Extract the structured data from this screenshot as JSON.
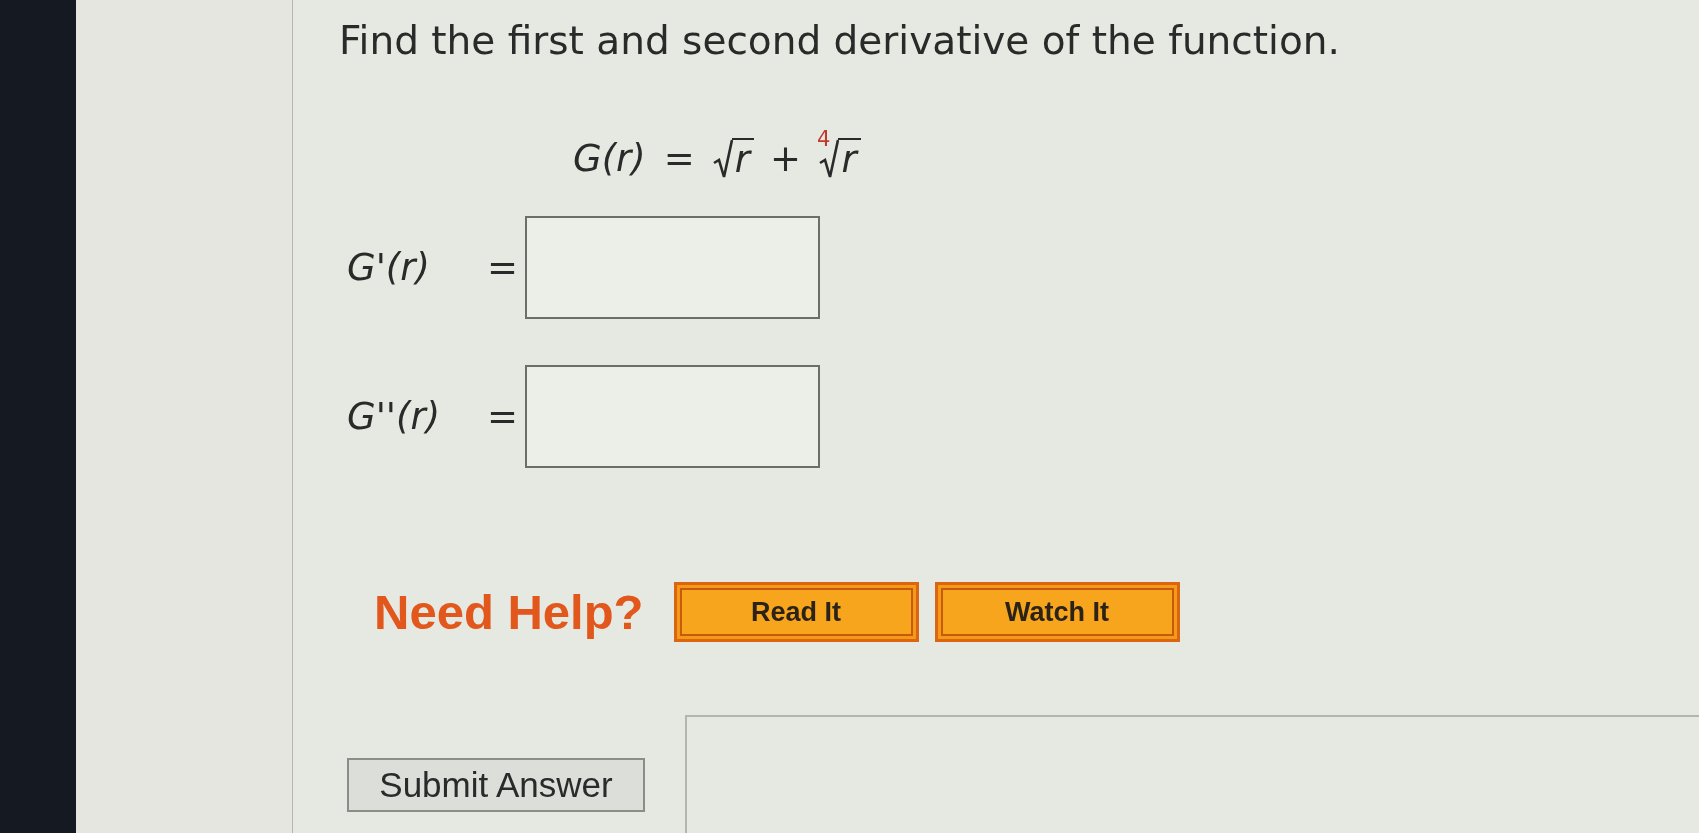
{
  "question": {
    "prompt": "Find the first and second derivative of the function."
  },
  "function": {
    "lhs": "G(r)",
    "equals": "=",
    "terms": [
      {
        "kind": "sqrt",
        "radicand": "r"
      },
      {
        "kind": "operator",
        "symbol": "+"
      },
      {
        "kind": "root",
        "index": "4",
        "radicand": "r"
      }
    ]
  },
  "answers": [
    {
      "label": "G'(r)",
      "equals": "="
    },
    {
      "label": "G''(r)",
      "equals": "="
    }
  ],
  "help": {
    "label": "Need Help?",
    "buttons": [
      "Read It",
      "Watch It"
    ]
  },
  "submit": {
    "label": "Submit Answer"
  }
}
